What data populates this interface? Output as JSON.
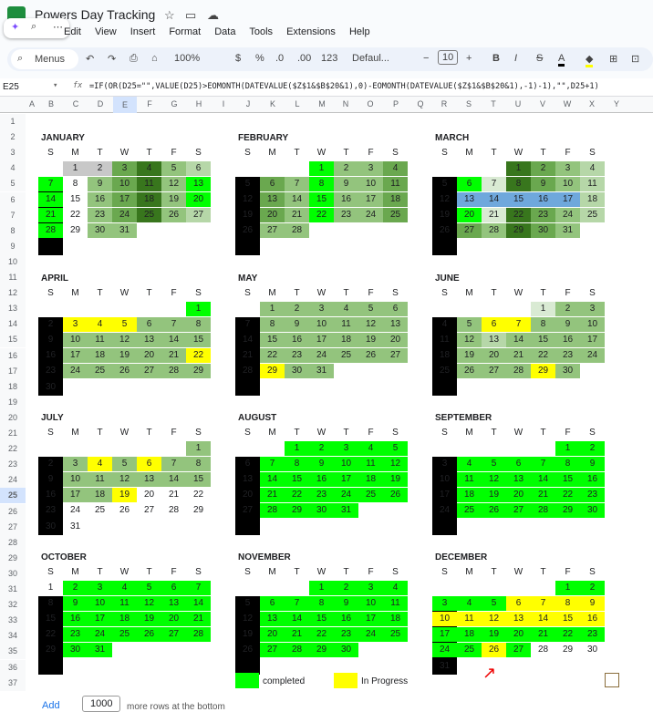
{
  "app": {
    "title": "Powers Day Tracking"
  },
  "menus": [
    "Edit",
    "View",
    "Insert",
    "Format",
    "Data",
    "Tools",
    "Extensions",
    "Help"
  ],
  "toolbar": {
    "search": "Menus",
    "zoom": "100%",
    "currency": "$",
    "percent": "%",
    "dec_minus": ".0",
    "dec_plus": ".00",
    "numfmt": "123",
    "font": "Defaul...",
    "size": "10",
    "bold": "B",
    "italic": "I",
    "strike": "S",
    "color": "A"
  },
  "fx": {
    "cell": "E25",
    "formula": "=IF(OR(D25=\"\",VALUE(D25)>EOMONTH(DATEVALUE($Z$1&$B$20&1),0)-EOMONTH(DATEVALUE($Z$1&$B$20&1),-1)-1),\"\",D25+1)"
  },
  "columns": [
    "A",
    "B",
    "C",
    "D",
    "E",
    "F",
    "G",
    "H",
    "I",
    "J",
    "K",
    "L",
    "M",
    "N",
    "O",
    "P",
    "Q",
    "R",
    "S",
    "T",
    "U",
    "V",
    "W",
    "X",
    "Y"
  ],
  "rows": [
    "1",
    "2",
    "3",
    "4",
    "5",
    "6",
    "7",
    "8",
    "9",
    "10",
    "11",
    "12",
    "13",
    "14",
    "15",
    "16",
    "17",
    "18",
    "19",
    "20",
    "21",
    "22",
    "23",
    "24",
    "25",
    "26",
    "27",
    "28",
    "29",
    "30",
    "31",
    "32",
    "33",
    "34",
    "35",
    "36",
    "37"
  ],
  "dow": [
    "S",
    "M",
    "T",
    "W",
    "T",
    "F",
    "S"
  ],
  "months": [
    {
      "name": "JANUARY",
      "start": 1,
      "days": 31,
      "colors": {
        "1": "#c8c8c8",
        "2": "#c8c8c8",
        "3": "#6aa84f",
        "4": "#38761d",
        "5": "#93c47d",
        "6": "#b6d7a8",
        "7": "#00ff00",
        "9": "#93c47d",
        "10": "#6aa84f",
        "11": "#38761d",
        "12": "#93c47d",
        "13": "#00ff00",
        "14": "#00ff00",
        "16": "#93c47d",
        "17": "#6aa84f",
        "18": "#38761d",
        "19": "#93c47d",
        "20": "#00ff00",
        "21": "#00ff00",
        "23": "#93c47d",
        "24": "#6aa84f",
        "25": "#38761d",
        "26": "#93c47d",
        "27": "#b6d7a8",
        "28": "#00ff00",
        "30": "#93c47d",
        "31": "#93c47d"
      }
    },
    {
      "name": "FEBRUARY",
      "start": 3,
      "days": 28,
      "colors": {
        "1": "#00ff00",
        "2": "#93c47d",
        "3": "#93c47d",
        "4": "#6aa84f",
        "6": "#6aa84f",
        "7": "#93c47d",
        "8": "#00ff00",
        "9": "#93c47d",
        "10": "#93c47d",
        "11": "#6aa84f",
        "13": "#6aa84f",
        "14": "#93c47d",
        "15": "#00ff00",
        "16": "#93c47d",
        "17": "#93c47d",
        "18": "#6aa84f",
        "20": "#6aa84f",
        "21": "#93c47d",
        "22": "#00ff00",
        "23": "#93c47d",
        "24": "#93c47d",
        "25": "#6aa84f",
        "27": "#93c47d",
        "28": "#93c47d"
      }
    },
    {
      "name": "MARCH",
      "start": 3,
      "days": 31,
      "colors": {
        "1": "#38761d",
        "2": "#6aa84f",
        "3": "#93c47d",
        "4": "#b6d7a8",
        "6": "#00ff00",
        "7": "#d9ead3",
        "8": "#38761d",
        "9": "#6aa84f",
        "10": "#93c47d",
        "11": "#b6d7a8",
        "13": "#6fa8dc",
        "14": "#6fa8dc",
        "15": "#6fa8dc",
        "16": "#6fa8dc",
        "17": "#6fa8dc",
        "18": "#b6d7a8",
        "20": "#00ff00",
        "21": "#d9ead3",
        "22": "#38761d",
        "23": "#6aa84f",
        "24": "#93c47d",
        "25": "#b6d7a8",
        "27": "#6aa84f",
        "28": "#93c47d",
        "29": "#38761d",
        "30": "#6aa84f",
        "31": "#93c47d"
      }
    },
    {
      "name": "APRIL",
      "start": 6,
      "days": 30,
      "colors": {
        "1": "#00ff00",
        "3": "#ffff00",
        "4": "#ffff00",
        "5": "#ffff00",
        "6": "#93c47d",
        "7": "#93c47d",
        "8": "#93c47d",
        "10": "#93c47d",
        "11": "#93c47d",
        "12": "#93c47d",
        "13": "#93c47d",
        "14": "#93c47d",
        "15": "#93c47d",
        "17": "#93c47d",
        "18": "#93c47d",
        "19": "#93c47d",
        "20": "#93c47d",
        "21": "#93c47d",
        "22": "#ffff00",
        "24": "#93c47d",
        "25": "#93c47d",
        "26": "#93c47d",
        "27": "#93c47d",
        "28": "#93c47d",
        "29": "#93c47d"
      }
    },
    {
      "name": "MAY",
      "start": 1,
      "days": 31,
      "colors": {
        "1": "#93c47d",
        "2": "#93c47d",
        "3": "#93c47d",
        "4": "#93c47d",
        "5": "#93c47d",
        "6": "#93c47d",
        "8": "#93c47d",
        "9": "#93c47d",
        "10": "#93c47d",
        "11": "#93c47d",
        "12": "#93c47d",
        "13": "#93c47d",
        "15": "#93c47d",
        "16": "#93c47d",
        "17": "#93c47d",
        "18": "#93c47d",
        "19": "#93c47d",
        "20": "#93c47d",
        "22": "#93c47d",
        "23": "#93c47d",
        "24": "#93c47d",
        "25": "#93c47d",
        "26": "#93c47d",
        "27": "#93c47d",
        "29": "#ffff00",
        "30": "#93c47d",
        "31": "#93c47d"
      }
    },
    {
      "name": "JUNE",
      "start": 4,
      "days": 30,
      "colors": {
        "1": "#d9ead3",
        "2": "#93c47d",
        "3": "#93c47d",
        "5": "#93c47d",
        "6": "#ffff00",
        "7": "#ffff00",
        "8": "#93c47d",
        "9": "#93c47d",
        "10": "#93c47d",
        "12": "#93c47d",
        "13": "#b6d7a8",
        "14": "#93c47d",
        "15": "#93c47d",
        "16": "#93c47d",
        "17": "#93c47d",
        "19": "#93c47d",
        "20": "#93c47d",
        "21": "#93c47d",
        "22": "#93c47d",
        "23": "#93c47d",
        "24": "#93c47d",
        "26": "#93c47d",
        "27": "#93c47d",
        "28": "#93c47d",
        "29": "#ffff00",
        "30": "#93c47d"
      }
    },
    {
      "name": "JULY",
      "start": 6,
      "days": 31,
      "colors": {
        "1": "#93c47d",
        "3": "#93c47d",
        "4": "#ffff00",
        "5": "#93c47d",
        "6": "#ffff00",
        "7": "#93c47d",
        "8": "#93c47d",
        "10": "#93c47d",
        "11": "#93c47d",
        "12": "#93c47d",
        "13": "#93c47d",
        "14": "#93c47d",
        "15": "#93c47d",
        "17": "#93c47d",
        "18": "#93c47d",
        "19": "#ffff00"
      }
    },
    {
      "name": "AUGUST",
      "start": 2,
      "days": 31,
      "colors": {
        "1": "#00ff00",
        "2": "#00ff00",
        "3": "#00ff00",
        "4": "#00ff00",
        "5": "#00ff00",
        "7": "#00ff00",
        "8": "#00ff00",
        "9": "#00ff00",
        "10": "#00ff00",
        "11": "#00ff00",
        "12": "#00ff00",
        "14": "#00ff00",
        "15": "#00ff00",
        "16": "#00ff00",
        "17": "#00ff00",
        "18": "#00ff00",
        "19": "#00ff00",
        "21": "#00ff00",
        "22": "#00ff00",
        "23": "#00ff00",
        "24": "#00ff00",
        "25": "#00ff00",
        "26": "#00ff00",
        "28": "#00ff00",
        "29": "#00ff00",
        "30": "#00ff00",
        "31": "#00ff00"
      }
    },
    {
      "name": "SEPTEMBER",
      "start": 5,
      "days": 30,
      "colors": {
        "1": "#00ff00",
        "2": "#00ff00",
        "4": "#00ff00",
        "5": "#00ff00",
        "6": "#00ff00",
        "7": "#00ff00",
        "8": "#00ff00",
        "9": "#00ff00",
        "11": "#00ff00",
        "12": "#00ff00",
        "13": "#00ff00",
        "14": "#00ff00",
        "15": "#00ff00",
        "16": "#00ff00",
        "18": "#00ff00",
        "19": "#00ff00",
        "20": "#00ff00",
        "21": "#00ff00",
        "22": "#00ff00",
        "23": "#00ff00",
        "25": "#00ff00",
        "26": "#00ff00",
        "27": "#00ff00",
        "28": "#00ff00",
        "29": "#00ff00",
        "30": "#00ff00"
      }
    },
    {
      "name": "OCTOBER",
      "start": 0,
      "days": 31,
      "colors": {
        "2": "#00ff00",
        "3": "#00ff00",
        "4": "#00ff00",
        "5": "#00ff00",
        "6": "#00ff00",
        "7": "#00ff00",
        "9": "#00ff00",
        "10": "#00ff00",
        "11": "#00ff00",
        "12": "#00ff00",
        "13": "#00ff00",
        "14": "#00ff00",
        "16": "#00ff00",
        "17": "#00ff00",
        "18": "#00ff00",
        "19": "#00ff00",
        "20": "#00ff00",
        "21": "#00ff00",
        "23": "#00ff00",
        "24": "#00ff00",
        "25": "#00ff00",
        "26": "#00ff00",
        "27": "#00ff00",
        "28": "#00ff00",
        "30": "#00ff00",
        "31": "#00ff00"
      }
    },
    {
      "name": "NOVEMBER",
      "start": 3,
      "days": 30,
      "colors": {
        "1": "#00ff00",
        "2": "#00ff00",
        "3": "#00ff00",
        "4": "#00ff00",
        "6": "#00ff00",
        "7": "#00ff00",
        "8": "#00ff00",
        "9": "#00ff00",
        "10": "#00ff00",
        "11": "#00ff00",
        "13": "#00ff00",
        "14": "#00ff00",
        "15": "#00ff00",
        "16": "#00ff00",
        "17": "#00ff00",
        "18": "#00ff00",
        "20": "#00ff00",
        "21": "#00ff00",
        "22": "#00ff00",
        "23": "#00ff00",
        "24": "#00ff00",
        "25": "#00ff00",
        "27": "#00ff00",
        "28": "#00ff00",
        "29": "#00ff00",
        "30": "#00ff00"
      }
    },
    {
      "name": "DECEMBER",
      "start": 5,
      "days": 31,
      "colors": {
        "1": "#00ff00",
        "2": "#00ff00",
        "3": "#00ff00",
        "4": "#00ff00",
        "5": "#00ff00",
        "6": "#ffff00",
        "7": "#ffff00",
        "8": "#ffff00",
        "9": "#ffff00",
        "10": "#ffff00",
        "11": "#ffff00",
        "12": "#ffff00",
        "13": "#ffff00",
        "14": "#ffff00",
        "15": "#ffff00",
        "16": "#ffff00",
        "17": "#00ff00",
        "18": "#00ff00",
        "19": "#00ff00",
        "20": "#00ff00",
        "21": "#00ff00",
        "22": "#00ff00",
        "23": "#00ff00",
        "24": "#00ff00",
        "25": "#00ff00",
        "26": "#ffff00",
        "27": "#00ff00"
      }
    }
  ],
  "legend": {
    "completed": "completed",
    "in_progress": "In Progress",
    "completed_color": "#00ff00",
    "in_progress_color": "#ffff00"
  },
  "footer": {
    "add": "Add",
    "rows": "1000",
    "more": "more rows at the bottom"
  }
}
